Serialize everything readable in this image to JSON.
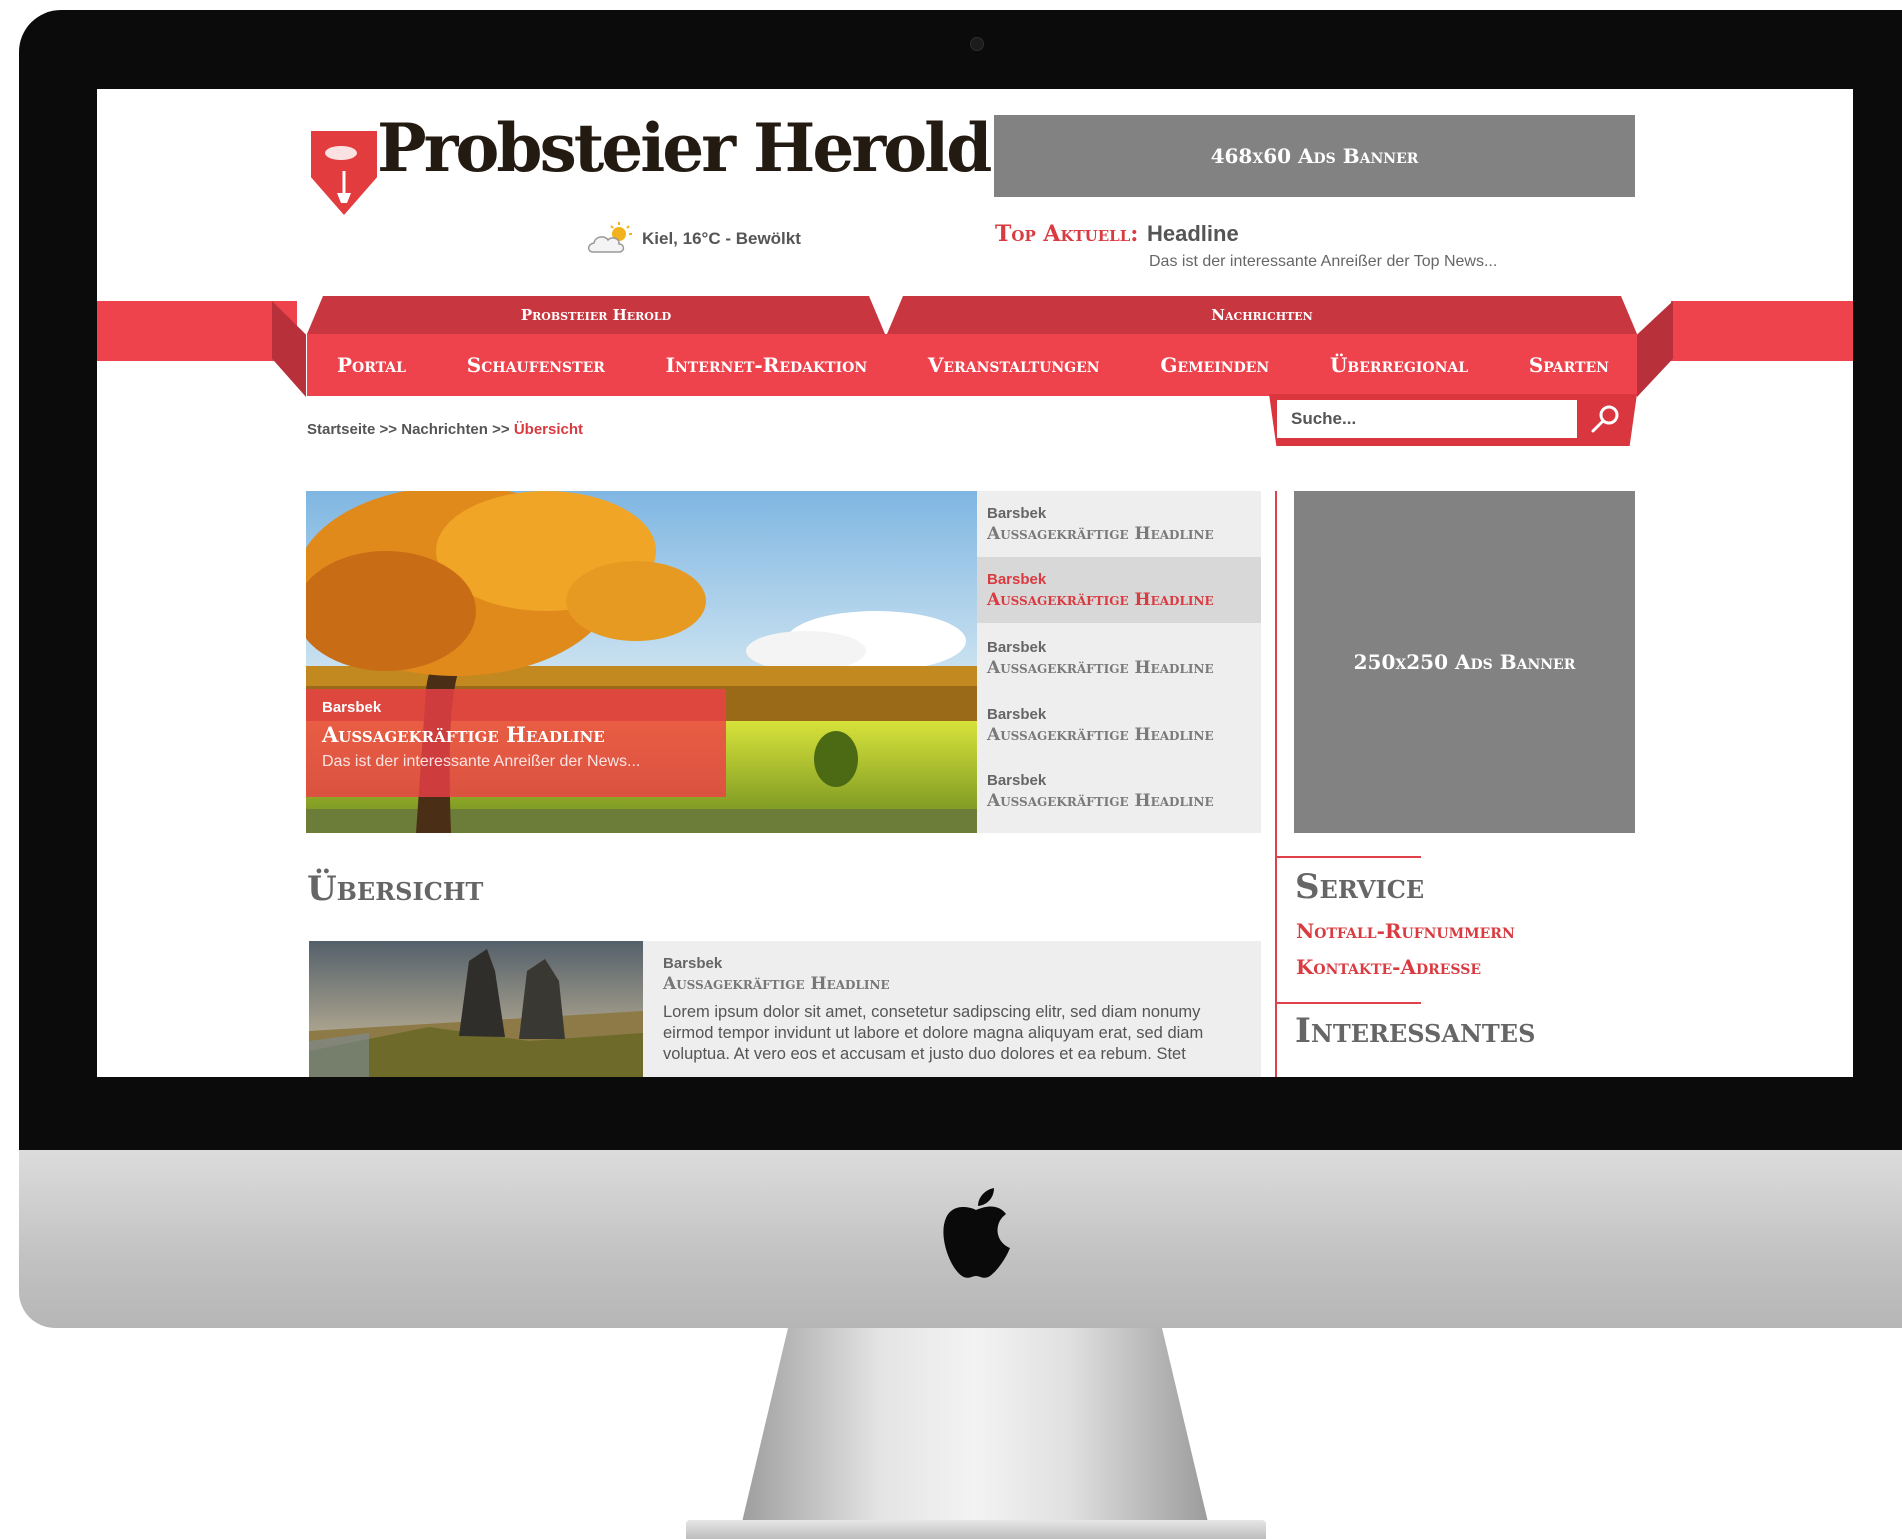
{
  "colors": {
    "accent": "#ee434d",
    "accent_dark": "#c8363f",
    "banner_gray": "#828282",
    "text_gray": "#666666"
  },
  "header": {
    "logo_text": "Probsteier Herold",
    "weather": {
      "icon": "partly-cloudy-icon",
      "text": "Kiel, 16°C - Bewölkt"
    },
    "ad_banner_top": "468x60 Ads Banner",
    "top_news": {
      "label": "Top Aktuell:",
      "headline": "Headline",
      "teaser": "Das ist der interessante Anreißer der Top News..."
    }
  },
  "nav": {
    "groups": [
      "Probsteier Herold",
      "Nachrichten"
    ],
    "items": [
      "Portal",
      "Schaufenster",
      "Internet-Redaktion",
      "Veranstaltungen",
      "Gemeinden",
      "Überregional",
      "Sparten"
    ]
  },
  "search": {
    "placeholder": "Suche..."
  },
  "breadcrumb": {
    "items": [
      "Startseite",
      "Nachrichten"
    ],
    "separator": ">>",
    "current": "Übersicht"
  },
  "slider": {
    "featured": {
      "location": "Barsbek",
      "headline": "Aussagekräftige Headline",
      "teaser": "Das ist der interessante Anreißer der News..."
    },
    "items": [
      {
        "location": "Barsbek",
        "headline": "Aussagekräftige Headline"
      },
      {
        "location": "Barsbek",
        "headline": "Aussagekräftige Headline"
      },
      {
        "location": "Barsbek",
        "headline": "Aussagekräftige Headline"
      },
      {
        "location": "Barsbek",
        "headline": "Aussagekräftige Headline"
      },
      {
        "location": "Barsbek",
        "headline": "Aussagekräftige Headline"
      }
    ],
    "active_index": 1
  },
  "main": {
    "section_title": "Übersicht",
    "article": {
      "location": "Barsbek",
      "headline": "Aussagekräftige Headline",
      "text": "Lorem ipsum dolor sit amet, consetetur sadipscing elitr, sed diam nonumy eirmod tempor invidunt ut labore et dolore magna aliquyam erat, sed diam voluptua. At vero eos et accusam et justo duo dolores et ea rebum. Stet"
    }
  },
  "sidebar": {
    "ad_banner": "250x250 Ads Banner",
    "service": {
      "title": "Service",
      "links": [
        "Notfall-Rufnummern",
        "Kontakte-Adresse"
      ]
    },
    "interessantes": {
      "title": "Interessantes"
    }
  },
  "device": {
    "logo_icon": "apple-logo-icon"
  }
}
